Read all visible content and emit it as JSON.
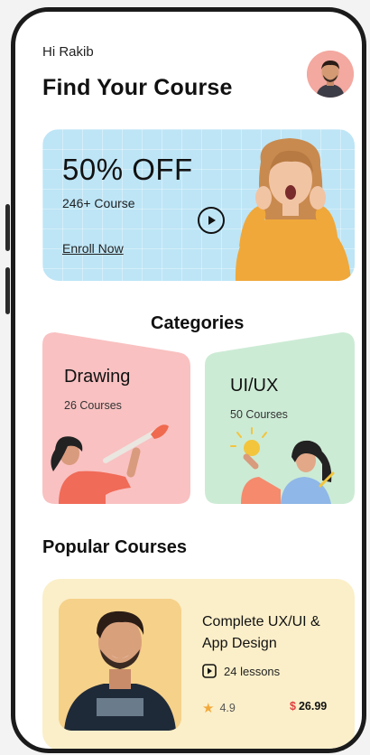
{
  "header": {
    "greeting": "Hi Rakib",
    "title": "Find Your Course"
  },
  "promo": {
    "title": "50% OFF",
    "subtitle": "246+ Course",
    "link": "Enroll Now"
  },
  "categories": {
    "title": "Categories",
    "items": [
      {
        "name": "Drawing",
        "count": "26 Courses",
        "color": "#f9c1c1"
      },
      {
        "name": "UI/UX",
        "count": "50 Courses",
        "color": "#ccebd5"
      }
    ]
  },
  "popular": {
    "title": "Popular Courses",
    "course": {
      "title": "Complete UX/UI & App Design",
      "lessons": "24 lessons",
      "rating": "4.9",
      "currency": "$",
      "price": "26.99"
    }
  },
  "colors": {
    "promo_bg": "#bde5f6",
    "course_bg": "#fbefc9",
    "star": "#f2a93b",
    "price_symbol": "#e04040"
  }
}
